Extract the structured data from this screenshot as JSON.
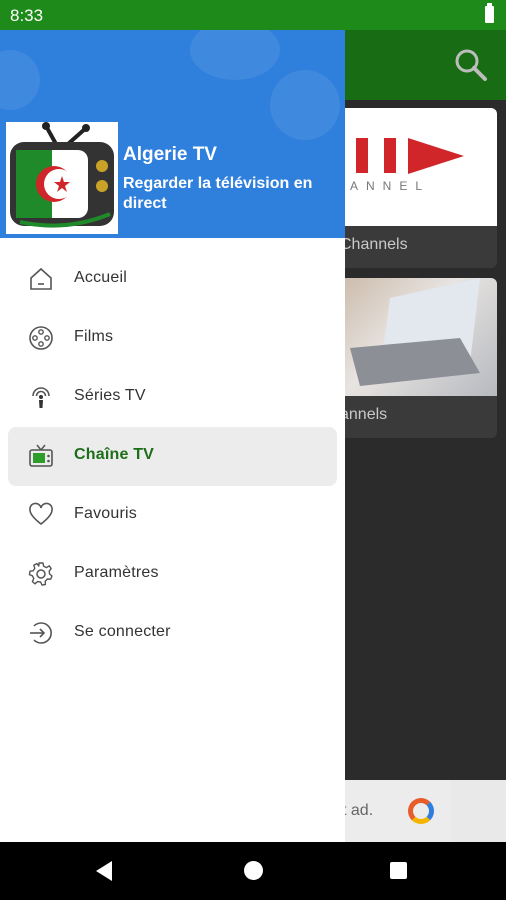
{
  "status_bar": {
    "time": "8:33"
  },
  "background": {
    "card1_label": "Channels",
    "card2_label": "annels",
    "card1_image_text": "ANNEL",
    "ad_text": "t ad."
  },
  "drawer": {
    "app_title": "Algerie TV",
    "app_subtitle": "Regarder la télévision en direct",
    "items": [
      {
        "label": "Accueil",
        "icon": "home-icon",
        "active": false
      },
      {
        "label": "Films",
        "icon": "film-reel-icon",
        "active": false
      },
      {
        "label": "Séries TV",
        "icon": "broadcast-icon",
        "active": false
      },
      {
        "label": "Chaîne TV",
        "icon": "tv-icon",
        "active": true
      },
      {
        "label": "Favouris",
        "icon": "heart-icon",
        "active": false
      },
      {
        "label": "Paramètres",
        "icon": "gear-icon",
        "active": false
      },
      {
        "label": "Se connecter",
        "icon": "login-icon",
        "active": false
      }
    ]
  },
  "colors": {
    "status_bar": "#1e8a1a",
    "toolbar": "#186d14",
    "drawer_header": "#2f7fdc",
    "active_text": "#1d6e18"
  }
}
